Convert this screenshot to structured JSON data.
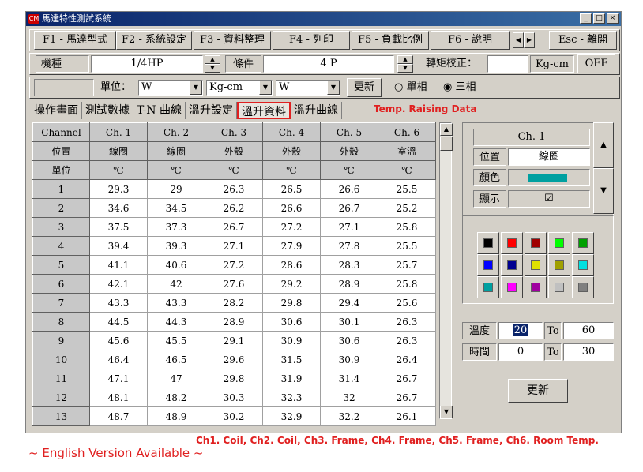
{
  "window": {
    "title": "馬達特性測試系統",
    "logo": "CM"
  },
  "titlebar_buttons": [
    "_",
    "□",
    "×"
  ],
  "function_keys": [
    "F1 - 馬達型式",
    "F2 - 系統設定",
    "F3 - 資料整理",
    "F4 - 列印",
    "F5 - 負載比例",
    "F6 - 說明",
    "Esc - 離開"
  ],
  "row2": {
    "model_label": "機種",
    "model_value": "1/4HP",
    "condition_label": "條件",
    "condition_value": "4 P",
    "torque_label": "轉矩校正：",
    "torque_value": "",
    "torque_unit": "Kg-cm",
    "off_label": "OFF"
  },
  "row3": {
    "unit_label": "單位：",
    "unit1": "W",
    "unit2": "Kg-cm",
    "unit3": "W",
    "update_label": "更新",
    "single_phase": "單相",
    "three_phase": "三相",
    "selected_phase": "三相"
  },
  "tabs": [
    "操作畫面",
    "測試數據",
    "T-N 曲線",
    "溫升設定",
    "溫升資料",
    "溫升曲線"
  ],
  "active_tab": "溫升資料",
  "tab_annotation": "Temp. Raising Data",
  "table": {
    "header_labels": [
      "Channel",
      "位置",
      "單位"
    ],
    "channels": [
      "Ch. 1",
      "Ch. 2",
      "Ch. 3",
      "Ch. 4",
      "Ch. 5",
      "Ch. 6"
    ],
    "positions": [
      "線圈",
      "線圈",
      "外殼",
      "外殼",
      "外殼",
      "室溫"
    ],
    "units": [
      "℃",
      "℃",
      "℃",
      "℃",
      "℃",
      "℃"
    ],
    "rows": [
      {
        "n": "1",
        "v": [
          "29.3",
          "29",
          "26.3",
          "26.5",
          "26.6",
          "25.5"
        ]
      },
      {
        "n": "2",
        "v": [
          "34.6",
          "34.5",
          "26.2",
          "26.6",
          "26.7",
          "25.2"
        ]
      },
      {
        "n": "3",
        "v": [
          "37.5",
          "37.3",
          "26.7",
          "27.2",
          "27.1",
          "25.8"
        ]
      },
      {
        "n": "4",
        "v": [
          "39.4",
          "39.3",
          "27.1",
          "27.9",
          "27.8",
          "25.5"
        ]
      },
      {
        "n": "5",
        "v": [
          "41.1",
          "40.6",
          "27.2",
          "28.6",
          "28.3",
          "25.7"
        ]
      },
      {
        "n": "6",
        "v": [
          "42.1",
          "42",
          "27.6",
          "29.2",
          "28.9",
          "25.8"
        ]
      },
      {
        "n": "7",
        "v": [
          "43.3",
          "43.3",
          "28.2",
          "29.8",
          "29.4",
          "25.6"
        ]
      },
      {
        "n": "8",
        "v": [
          "44.5",
          "44.3",
          "28.9",
          "30.6",
          "30.1",
          "26.3"
        ]
      },
      {
        "n": "9",
        "v": [
          "45.6",
          "45.5",
          "29.1",
          "30.9",
          "30.6",
          "26.3"
        ]
      },
      {
        "n": "10",
        "v": [
          "46.4",
          "46.5",
          "29.6",
          "31.5",
          "30.9",
          "26.4"
        ]
      },
      {
        "n": "11",
        "v": [
          "47.1",
          "47",
          "29.8",
          "31.9",
          "31.4",
          "26.7"
        ]
      },
      {
        "n": "12",
        "v": [
          "48.1",
          "48.2",
          "30.3",
          "32.3",
          "32",
          "26.7"
        ]
      },
      {
        "n": "13",
        "v": [
          "48.7",
          "48.9",
          "30.2",
          "32.9",
          "32.2",
          "26.1"
        ]
      }
    ]
  },
  "side_panel": {
    "channel": "Ch. 1",
    "position_label": "位置",
    "position_value": "線圈",
    "color_label": "顏色",
    "color_value": "#00a0a0",
    "display_label": "顯示",
    "display_checked": "☑",
    "palette": [
      "#000000",
      "#ff0000",
      "#a00000",
      "#00ff00",
      "#00a000",
      "#0000ff",
      "#000090",
      "#e0e000",
      "#a0a000",
      "#00e0e0",
      "#00a0a0",
      "#ff00ff",
      "#a000a0",
      "#c0c0c0",
      "#808080"
    ],
    "temp_label": "溫度",
    "temp_from": "20",
    "to1": "To",
    "temp_to": "60",
    "time_label": "時間",
    "time_from": "0",
    "to2": "To",
    "time_to": "30",
    "update_label": "更新"
  },
  "footer_annotation": "Ch1. Coil, Ch2. Coil, Ch3. Frame, Ch4. Frame, Ch5. Frame, Ch6. Room Temp.",
  "english_note": "~ English Version Available ~"
}
